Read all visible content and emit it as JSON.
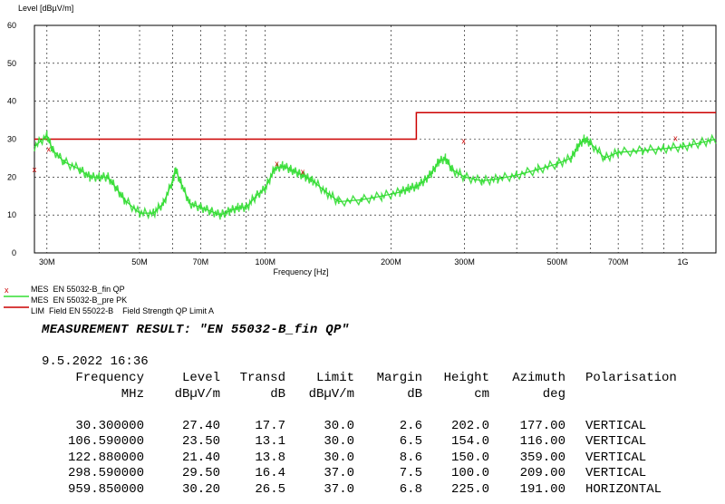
{
  "chart_data": {
    "type": "line",
    "title": "",
    "ylabel": "Level [dBµV/m]",
    "xlabel": "Frequency [Hz]",
    "x_scale": "log",
    "xlim_mhz": [
      28,
      1200
    ],
    "ylim": [
      0,
      60
    ],
    "yticks": [
      0,
      10,
      20,
      30,
      40,
      50,
      60
    ],
    "ytick_labels": [
      "0",
      "10",
      "20",
      "30",
      "40",
      "50",
      "60"
    ],
    "xticks_mhz": [
      30,
      50,
      70,
      100,
      200,
      300,
      500,
      700,
      1000
    ],
    "xtick_labels": [
      "30M",
      "50M",
      "70M",
      "100M",
      "200M",
      "300M",
      "500M",
      "700M",
      "1G"
    ],
    "grid": true,
    "series": [
      {
        "name": "Field Strength QP Limit A",
        "color": "#cc0000",
        "x_mhz": [
          28,
          230,
          230,
          1200
        ],
        "y": [
          30,
          30,
          37,
          37
        ]
      },
      {
        "name": "EN 55032-B_pre PK",
        "color": "#33dd33",
        "x_mhz": [
          28,
          30,
          31,
          33,
          36,
          38,
          40,
          42,
          44,
          46,
          50,
          54,
          57,
          60,
          61,
          63,
          66,
          70,
          74,
          78,
          82,
          86,
          90,
          95,
          100,
          105,
          110,
          115,
          120,
          125,
          130,
          140,
          150,
          170,
          190,
          210,
          220,
          230,
          240,
          250,
          260,
          270,
          280,
          300,
          330,
          360,
          400,
          450,
          500,
          540,
          560,
          580,
          600,
          650,
          700,
          800,
          900,
          1000,
          1100,
          1200
        ],
        "y": [
          28,
          31,
          27,
          24,
          22,
          20,
          20,
          20,
          17,
          14,
          10.5,
          10.5,
          13,
          19,
          22,
          18,
          13,
          12,
          11,
          10,
          11,
          12,
          12,
          15,
          17,
          22,
          23,
          22,
          21,
          20,
          19,
          16,
          13.5,
          14,
          15,
          16,
          17,
          17.5,
          19,
          21,
          24,
          25,
          22,
          20,
          19,
          19.5,
          20.5,
          22,
          23.5,
          25,
          28,
          30,
          29,
          25,
          26.5,
          27,
          27.5,
          28,
          29,
          30
        ]
      }
    ],
    "markers": [
      {
        "name": "EN 55032-B_fin QP",
        "marker": "x",
        "color": "#cc0000",
        "x_mhz": [
          28,
          30.3,
          106.59,
          122.88,
          298.59,
          959.85
        ],
        "y": [
          22,
          27.4,
          23.5,
          21.4,
          29.5,
          30.2
        ]
      }
    ]
  },
  "legend": [
    {
      "mark": "x",
      "prefix": "MES",
      "name": "EN 55032-B_fin QP",
      "suffix": ""
    },
    {
      "mark": "green-line",
      "prefix": "MES",
      "name": "EN 55032-B_pre PK",
      "suffix": ""
    },
    {
      "mark": "red-line",
      "prefix": "LIM",
      "name": "Field EN 55022-B",
      "suffix": "Field Strength QP Limit A"
    }
  ],
  "result": {
    "title": "MEASUREMENT RESULT: \"EN 55032-B_fin QP\"",
    "date": "9.5.2022   16:36",
    "headers": [
      "Frequency",
      "Level",
      "Transd",
      "Limit",
      "Margin",
      "Height",
      "Azimuth",
      "Polarisation"
    ],
    "units": [
      "MHz",
      "dBµV/m",
      "dB",
      "dBµV/m",
      "dB",
      "cm",
      "deg",
      ""
    ],
    "rows": [
      [
        "30.300000",
        "27.40",
        "17.7",
        "30.0",
        "2.6",
        "202.0",
        "177.00",
        "VERTICAL"
      ],
      [
        "106.590000",
        "23.50",
        "13.1",
        "30.0",
        "6.5",
        "154.0",
        "116.00",
        "VERTICAL"
      ],
      [
        "122.880000",
        "21.40",
        "13.8",
        "30.0",
        "8.6",
        "150.0",
        "359.00",
        "VERTICAL"
      ],
      [
        "298.590000",
        "29.50",
        "16.4",
        "37.0",
        "7.5",
        "100.0",
        "209.00",
        "VERTICAL"
      ],
      [
        "959.850000",
        "30.20",
        "26.5",
        "37.0",
        "6.8",
        "225.0",
        "191.00",
        "HORIZONTAL"
      ]
    ]
  }
}
